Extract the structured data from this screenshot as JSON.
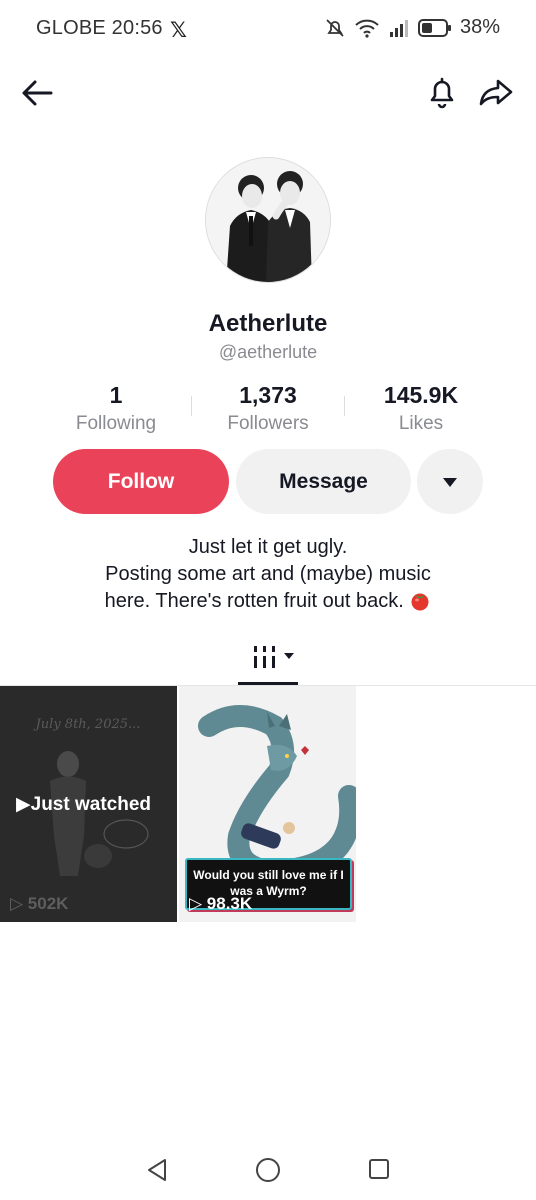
{
  "status_bar": {
    "carrier_time": "GLOBE 20:56",
    "x_logo": "𝕏",
    "battery": "38%"
  },
  "profile": {
    "display_name": "Aetherlute",
    "username": "@aetherlute"
  },
  "stats": [
    {
      "value": "1",
      "label": "Following"
    },
    {
      "value": "1,373",
      "label": "Followers"
    },
    {
      "value": "145.9K",
      "label": "Likes"
    }
  ],
  "actions": {
    "follow": "Follow",
    "message": "Message"
  },
  "bio": {
    "line1": "Just let it get ugly.",
    "line2": "Posting some art and (maybe) music",
    "line3": "here. There's rotten fruit out back."
  },
  "videos": [
    {
      "badge": "Just watched",
      "views": "502K",
      "thumb_text": "July 8th, 2025..."
    },
    {
      "caption": "Would you still love me if I was a Wyrm?",
      "views": "98.3K"
    }
  ],
  "colors": {
    "follow_button": "#ea4359",
    "secondary_button": "#f1f1f2",
    "text_primary": "#161823",
    "text_secondary": "#8a8b91"
  }
}
